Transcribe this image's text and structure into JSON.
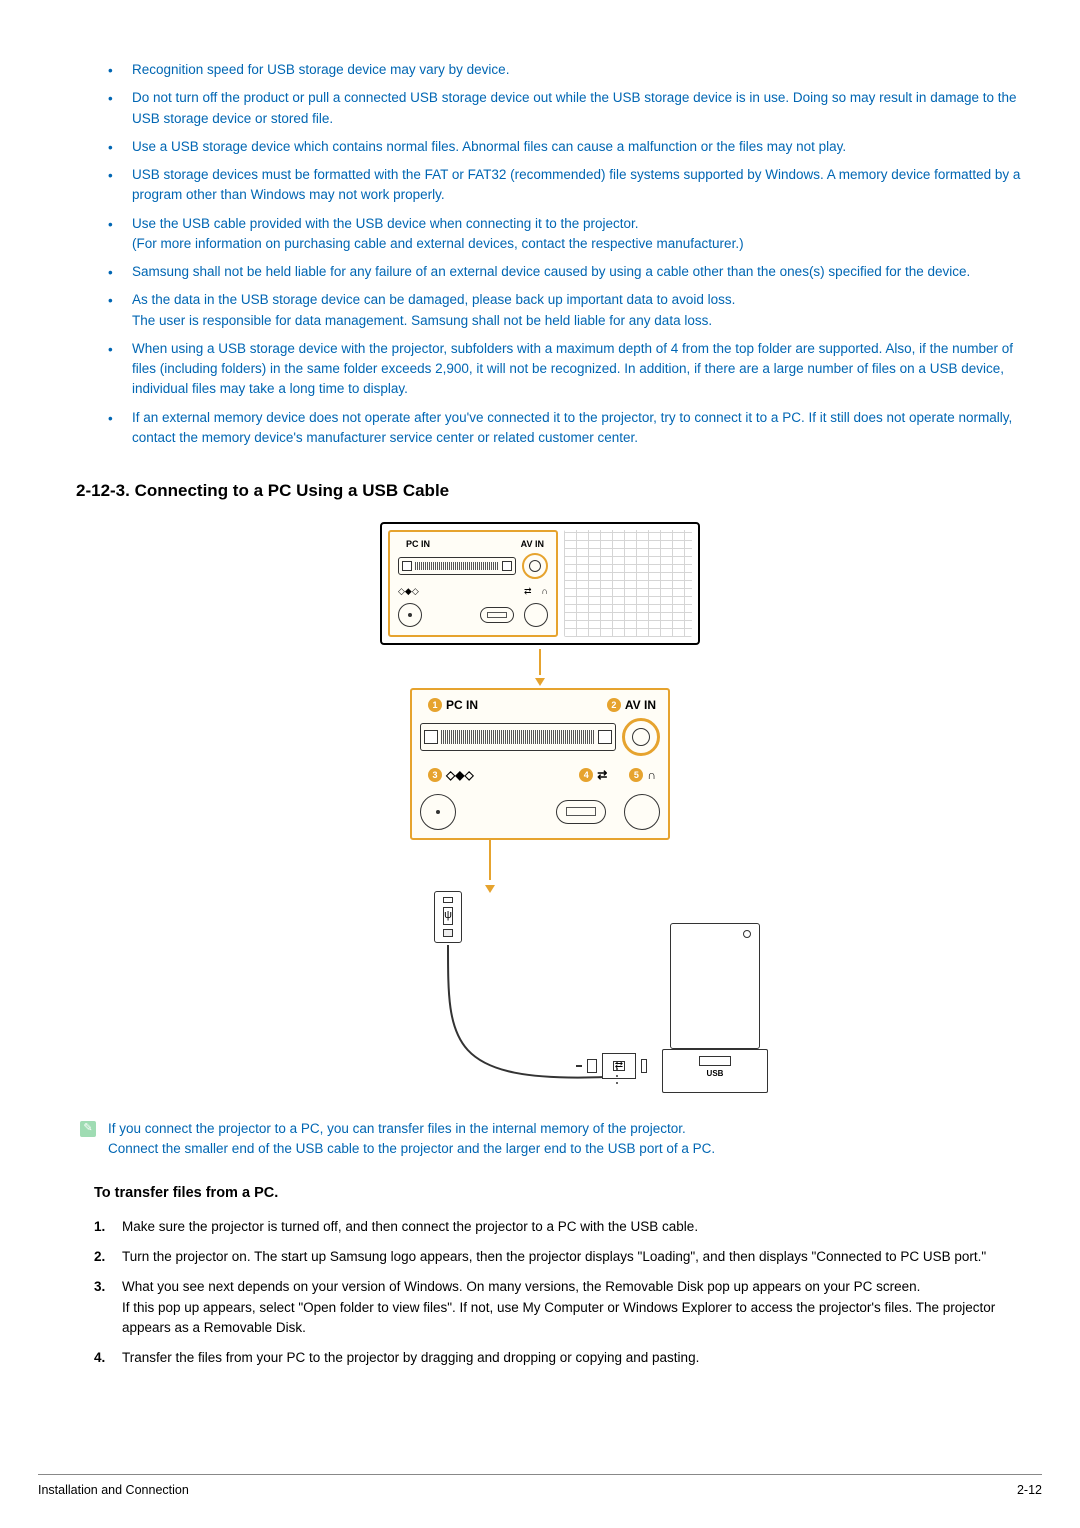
{
  "bullets": [
    "Recognition speed for USB storage device may vary by device.",
    "Do not turn off the product or pull a connected USB storage device out while the USB storage device is in use. Doing so may result in damage to the USB storage device or stored file.",
    "Use a USB storage device which contains normal files. Abnormal files can cause a malfunction or the files may not play.",
    "USB storage devices must be formatted with the FAT or FAT32 (recommended) file systems supported by Windows. A memory device formatted by a program other than Windows may not work properly.",
    "Use the USB cable provided with the USB device when connecting it to the projector.\n(For more information on purchasing cable and external devices, contact the respective manufacturer.)",
    "Samsung shall not be held liable for any failure of an external device caused by using a cable other than the ones(s) specified for the device.",
    "As the data in the USB storage device can be damaged, please back up important data to avoid loss.\nThe user is responsible for data management. Samsung shall not be held liable for any data loss.",
    "When using a USB storage device with the projector, subfolders with a maximum depth of 4 from the top folder are supported. Also, if the number of files (including folders) in the same folder exceeds 2,900, it will not be recognized. In addition, if there are a large number of files on a USB device, individual files may take a long time to display.",
    "If an external memory device does not operate after you've connected it to the projector, try to connect it to a PC. If it still does not operate normally, contact the memory device's manufacturer service center or related customer center."
  ],
  "section_title": "2-12-3. Connecting to a PC Using a USB Cable",
  "diagram": {
    "pc_in": "PC IN",
    "av_in": "AV IN",
    "badge1": "1",
    "badge2": "2",
    "badge3": "3",
    "badge4": "4",
    "badge5": "5",
    "usb_glyph": "⬌",
    "headphone_glyph": "🎧",
    "pc_usb_label": "USB",
    "psi": "ψ"
  },
  "note": {
    "line1": "If you connect the projector to a PC, you can transfer files in the internal memory of the projector.",
    "line2": "Connect the smaller end of the USB cable to the projector and the larger end to the USB port of a PC."
  },
  "sub_heading": "To transfer files from a PC.",
  "steps": [
    {
      "n": "1.",
      "t": "Make sure the projector is turned off, and then connect the projector to a PC with the USB cable."
    },
    {
      "n": "2.",
      "t": "Turn the projector on. The start up Samsung logo appears, then the projector displays \"Loading\", and then displays \"Connected to PC USB port.\""
    },
    {
      "n": "3.",
      "t": "What you see next depends on your version of Windows. On many versions, the Removable Disk pop up appears on your PC screen.\nIf this pop up appears, select \"Open folder to view files\". If not, use My Computer or Windows Explorer to access the projector's files. The projector appears as a Removable Disk."
    },
    {
      "n": "4.",
      "t": "Transfer the files from your PC to the projector by dragging and dropping or copying and pasting."
    }
  ],
  "footer": {
    "left": "Installation and Connection",
    "right": "2-12"
  }
}
